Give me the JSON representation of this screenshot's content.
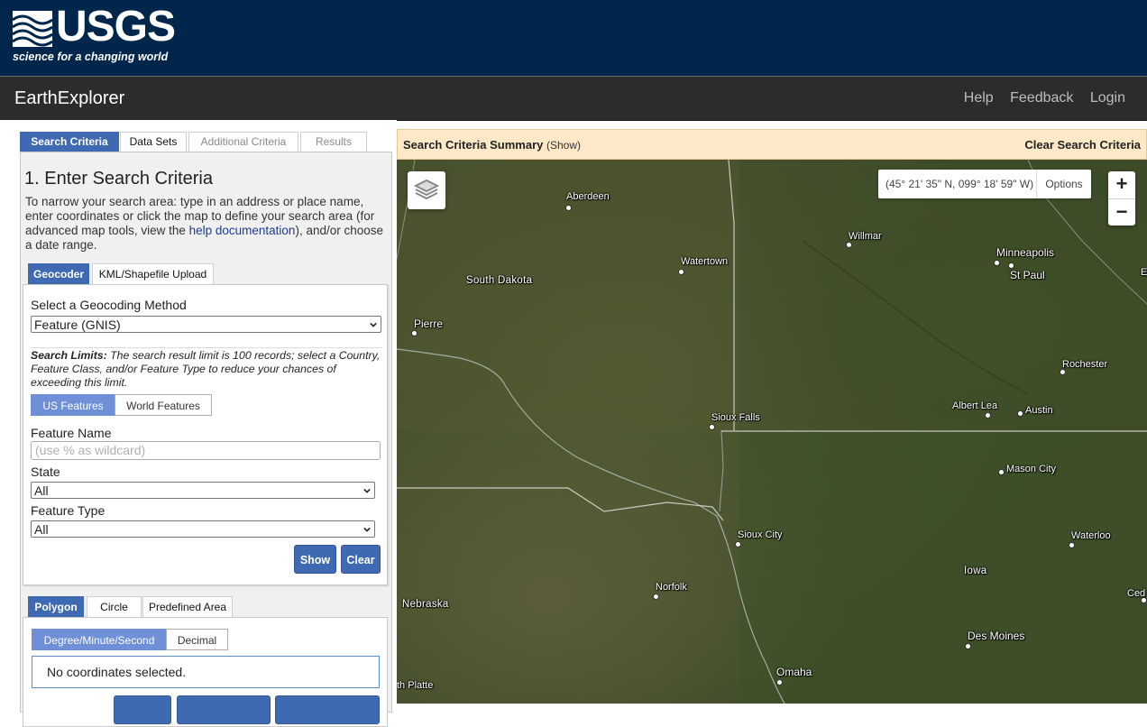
{
  "header": {
    "logo_text": "USGS",
    "tagline": "science for a changing world"
  },
  "navbar": {
    "title": "EarthExplorer",
    "links": [
      "Help",
      "Feedback",
      "Login"
    ]
  },
  "main_tabs": [
    "Search Criteria",
    "Data Sets",
    "Additional Criteria",
    "Results"
  ],
  "criteria": {
    "heading": "1. Enter Search Criteria",
    "intro_before": "To narrow your search area: type in an address or place name, enter coordinates or click the map to define your search area (for advanced map tools, view the ",
    "intro_link": "help documentation",
    "intro_after": "), and/or choose a date range.",
    "sub_tabs": [
      "Geocoder",
      "KML/Shapefile Upload"
    ],
    "method_label": "Select a Geocoding Method",
    "method_value": "Feature (GNIS)",
    "limits_bold": "Search Limits:",
    "limits_text": " The search result limit is 100 records; select a Country, Feature Class, and/or Feature Type to reduce your chances of exceeding this limit.",
    "feature_scope": [
      "US Features",
      "World Features"
    ],
    "feature_name_label": "Feature Name",
    "feature_name_placeholder": "(use % as wildcard)",
    "state_label": "State",
    "state_value": "All",
    "feature_type_label": "Feature Type",
    "feature_type_value": "All",
    "show_label": "Show",
    "clear_label": "Clear"
  },
  "area": {
    "tabs": [
      "Polygon",
      "Circle",
      "Predefined Area"
    ],
    "formats": [
      "Degree/Minute/Second",
      "Decimal"
    ],
    "coords_text": "No coordinates selected."
  },
  "summary": {
    "title": "Search Criteria Summary",
    "show": "(Show)",
    "clear": "Clear Search Criteria"
  },
  "map": {
    "coordinates": "(45° 21' 35\" N, 099° 18' 59\" W)",
    "options": "Options",
    "zoom_in": "+",
    "zoom_out": "−",
    "cities": [
      "Aberdeen",
      "Willmar",
      "Watertown",
      "Minneapolis",
      "St Paul",
      "E",
      "Pierre",
      "Rochester",
      "Albert Lea",
      "Austin",
      "Sioux Falls",
      "Mason City",
      "Sioux City",
      "Waterloo",
      "Norfolk",
      "Ced",
      "Omaha",
      "Des Moines",
      "th Platte"
    ],
    "regions": [
      "South Dakota",
      "Iowa",
      "Nebraska"
    ]
  }
}
